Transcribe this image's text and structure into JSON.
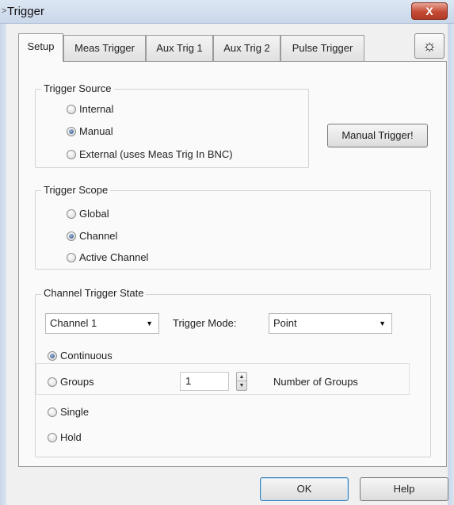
{
  "window": {
    "title": "Trigger",
    "close_label": "X"
  },
  "tabs": [
    {
      "label": "Setup",
      "active": true
    },
    {
      "label": "Meas Trigger",
      "active": false
    },
    {
      "label": "Aux Trig 1",
      "active": false
    },
    {
      "label": "Aux Trig 2",
      "active": false
    },
    {
      "label": "Pulse Trigger",
      "active": false
    }
  ],
  "toolbar": {
    "sun_icon": "sun-icon"
  },
  "trigger_source": {
    "title": "Trigger Source",
    "options": [
      {
        "label": "Internal",
        "checked": false
      },
      {
        "label": "Manual",
        "checked": true
      },
      {
        "label": "External (uses Meas Trig In BNC)",
        "checked": false
      }
    ],
    "manual_trigger_label": "Manual Trigger!"
  },
  "trigger_scope": {
    "title": "Trigger Scope",
    "options": [
      {
        "label": "Global",
        "checked": false
      },
      {
        "label": "Channel",
        "checked": true
      },
      {
        "label": "Active Channel",
        "checked": false
      }
    ]
  },
  "channel_state": {
    "title": "Channel Trigger State",
    "channel_select": "Channel 1",
    "trigger_mode_label": "Trigger Mode:",
    "trigger_mode_select": "Point",
    "options": [
      {
        "label": "Continuous",
        "checked": true
      },
      {
        "label": "Groups",
        "checked": false
      },
      {
        "label": "Single",
        "checked": false
      },
      {
        "label": "Hold",
        "checked": false
      }
    ],
    "groups_value": "1",
    "groups_suffix": "Number of Groups"
  },
  "footer": {
    "ok_label": "OK",
    "help_label": "Help"
  }
}
